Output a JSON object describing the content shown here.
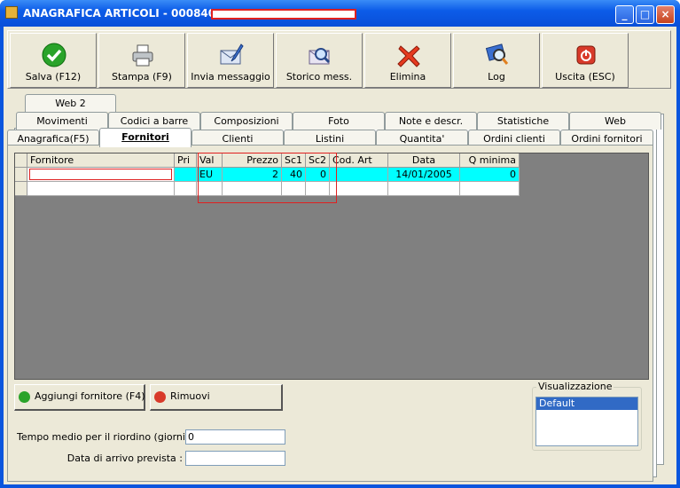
{
  "window": {
    "title": "ANAGRAFICA ARTICOLI - 0008402",
    "title_field": "",
    "minimize": "_",
    "maximize": "□",
    "close": "×"
  },
  "toolbar": [
    {
      "label": "Salva (F12)",
      "icon": "check-icon"
    },
    {
      "label": "Stampa (F9)",
      "icon": "printer-icon"
    },
    {
      "label": "Invia messaggio",
      "icon": "envelope-pen-icon"
    },
    {
      "label": "Storico mess.",
      "icon": "envelope-search-icon"
    },
    {
      "label": "Elimina",
      "icon": "delete-x-icon"
    },
    {
      "label": "Log",
      "icon": "log-search-icon"
    },
    {
      "label": "Uscita (ESC)",
      "icon": "exit-icon"
    }
  ],
  "tabs": {
    "row1": [
      "Web 2"
    ],
    "row2": [
      "Movimenti",
      "Codici a barre",
      "Composizioni",
      "Foto",
      "Note e descr.",
      "Statistiche",
      "Web"
    ],
    "row3": [
      "Anagrafica(F5)",
      "Fornitori",
      "Clienti",
      "Listini",
      "Quantita'",
      "Ordini clienti",
      "Ordini fornitori"
    ],
    "active": "Fornitori"
  },
  "grid": {
    "columns": [
      "Fornitore",
      "Pri",
      "Val",
      "Prezzo",
      "Sc1",
      "Sc2",
      "Cod. Art",
      "Data",
      "Q minima"
    ],
    "rows": [
      [
        "",
        "",
        "EU",
        "2",
        "40",
        "0",
        "",
        "14/01/2005",
        "0"
      ]
    ]
  },
  "buttons": {
    "add": "Aggiungi fornitore (F4)",
    "remove": "Rimuovi"
  },
  "fields": {
    "riordino_label": "Tempo medio per il riordino (giorni) :",
    "riordino_value": "0",
    "arrivo_label": "Data di arrivo prevista :",
    "arrivo_value": ""
  },
  "visualizzazione": {
    "label": "Visualizzazione",
    "items": [
      "Default"
    ]
  },
  "colors": {
    "titlebar": "#0a55de",
    "selected_row": "#00ffff",
    "highlight": "#e02020"
  }
}
